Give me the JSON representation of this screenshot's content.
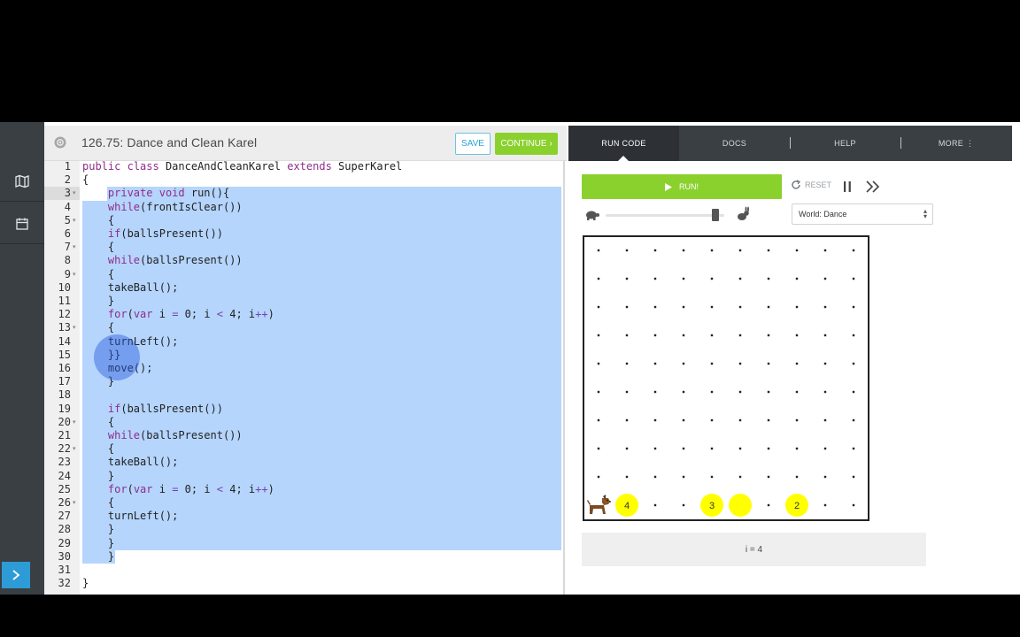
{
  "editor": {
    "title": "126.75: Dance and Clean Karel",
    "save_label": "SAVE",
    "continue_label": "CONTINUE ›",
    "lines": [
      {
        "n": "1",
        "text": "public class DanceAndCleanKarel extends SuperKarel"
      },
      {
        "n": "2",
        "text": "{"
      },
      {
        "n": "3",
        "text": "    private void run(){"
      },
      {
        "n": "4",
        "text": "    while(frontIsClear())"
      },
      {
        "n": "5",
        "text": "    {"
      },
      {
        "n": "6",
        "text": "    if(ballsPresent())"
      },
      {
        "n": "7",
        "text": "    {"
      },
      {
        "n": "8",
        "text": "    while(ballsPresent())"
      },
      {
        "n": "9",
        "text": "    {"
      },
      {
        "n": "10",
        "text": "    takeBall();"
      },
      {
        "n": "11",
        "text": "    }"
      },
      {
        "n": "12",
        "text": "    for(var i = 0; i < 4; i++)"
      },
      {
        "n": "13",
        "text": "    {"
      },
      {
        "n": "14",
        "text": "    turnLeft();"
      },
      {
        "n": "15",
        "text": "    }}"
      },
      {
        "n": "16",
        "text": "    move();"
      },
      {
        "n": "17",
        "text": "    }"
      },
      {
        "n": "18",
        "text": ""
      },
      {
        "n": "19",
        "text": "    if(ballsPresent())"
      },
      {
        "n": "20",
        "text": "    {"
      },
      {
        "n": "21",
        "text": "    while(ballsPresent())"
      },
      {
        "n": "22",
        "text": "    {"
      },
      {
        "n": "23",
        "text": "    takeBall();"
      },
      {
        "n": "24",
        "text": "    }"
      },
      {
        "n": "25",
        "text": "    for(var i = 0; i < 4; i++)"
      },
      {
        "n": "26",
        "text": "    {"
      },
      {
        "n": "27",
        "text": "    turnLeft();"
      },
      {
        "n": "28",
        "text": "    }"
      },
      {
        "n": "29",
        "text": "    }"
      },
      {
        "n": "30",
        "text": "    }"
      },
      {
        "n": "31",
        "text": ""
      },
      {
        "n": "32",
        "text": "}"
      }
    ],
    "fold_lines": [
      "3",
      "5",
      "7",
      "9",
      "13",
      "20",
      "22",
      "26"
    ],
    "active_line": "3",
    "selection": "lines 3-30"
  },
  "tabs": [
    "RUN CODE",
    "DOCS",
    "HELP",
    "MORE ⋮"
  ],
  "controls": {
    "run_label": "RUN!",
    "reset_label": "RESET",
    "world_select": "World: Dance",
    "speed": 0.93
  },
  "world": {
    "cols": 10,
    "rows": 10,
    "karel": {
      "col": 1,
      "row": 1,
      "icon": "dog-icon"
    },
    "balls": [
      {
        "col": 2,
        "row": 1,
        "count": "4"
      },
      {
        "col": 5,
        "row": 1,
        "count": "3"
      },
      {
        "col": 6,
        "row": 1,
        "count": ""
      },
      {
        "col": 8,
        "row": 1,
        "count": "2"
      }
    ],
    "ball_color": "#ffff00"
  },
  "status": "i = 4",
  "colors": {
    "accent_green": "#8bd12e",
    "selection": "#b5d5fd",
    "tab_bar": "#3a3f44"
  }
}
